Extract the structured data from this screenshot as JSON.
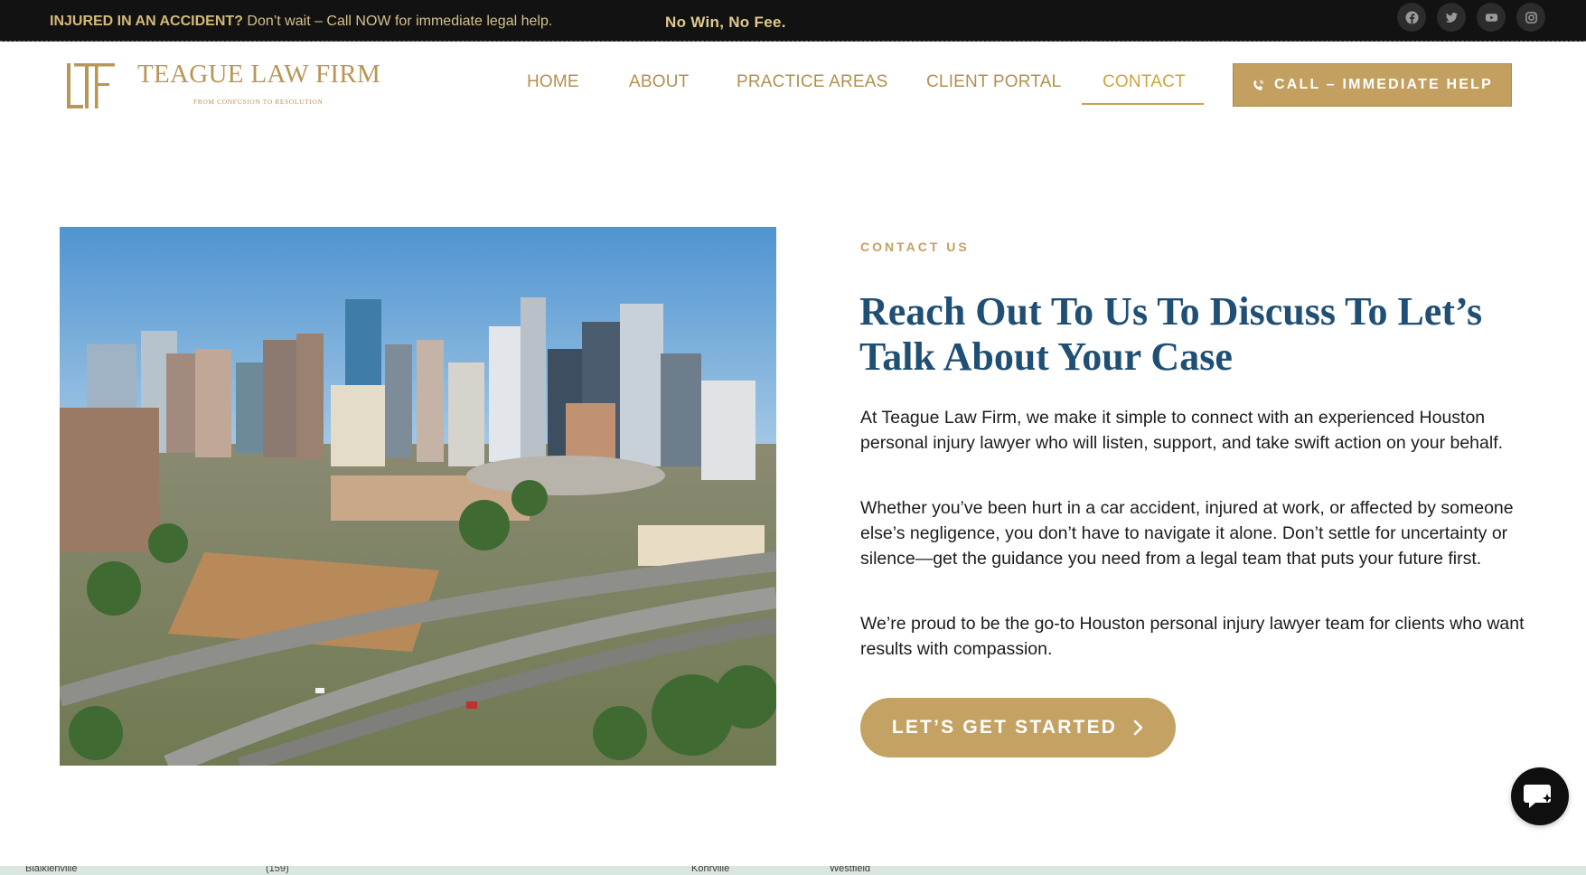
{
  "topbar": {
    "lead": "INJURED IN AN ACCIDENT?",
    "message": " Don’t wait – Call NOW for immediate legal help.",
    "tagline": "No Win, No Fee.",
    "social_icons": [
      "facebook-icon",
      "twitter-icon",
      "youtube-icon",
      "instagram-icon"
    ]
  },
  "logo": {
    "name": "TEAGUE LAW FIRM",
    "tagline": "FROM CONFUSION TO RESOLUTION"
  },
  "nav": {
    "items": [
      {
        "label": "HOME"
      },
      {
        "label": "ABOUT"
      },
      {
        "label": "PRACTICE AREAS"
      },
      {
        "label": "CLIENT PORTAL"
      },
      {
        "label": "CONTACT",
        "active": true
      }
    ],
    "call_button": "CALL – IMMEDIATE HELP"
  },
  "contact": {
    "eyebrow": "CONTACT US",
    "headline": "Reach Out To Us To Discuss To Let’s Talk About Your Case",
    "paragraphs": [
      "At Teague Law Firm, we make it simple to connect with an experienced Houston personal injury lawyer who will listen, support, and take swift action on your behalf.",
      "Whether you’ve been hurt in a car accident, injured at work, or affected by someone else’s negligence, you don’t have to navigate it alone. Don’t settle for uncertainty or silence—get the guidance you need from a legal team that puts your future first.",
      "We’re proud to be the go-to Houston personal injury lawyer team for clients who want results with compassion."
    ],
    "cta": "LET’S GET STARTED"
  },
  "map": {
    "labels": [
      "Blaiklenville",
      "(159)",
      "Kohrville",
      "Westfield"
    ]
  },
  "colors": {
    "gold": "#c3a060",
    "navy_heading": "#1f4f75",
    "topbar_bg": "#121212"
  }
}
